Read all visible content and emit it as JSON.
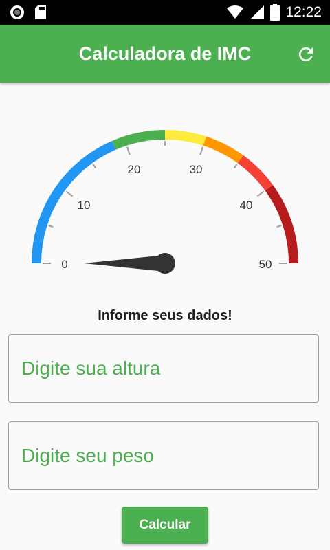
{
  "status_bar": {
    "time": "12:22",
    "icons": [
      "app-notification-icon",
      "sd-card-icon",
      "wifi-icon",
      "signal-icon",
      "battery-icon"
    ]
  },
  "app_bar": {
    "title": "Calculadora de IMC",
    "refresh_icon": "refresh-icon",
    "color": "#4caf50"
  },
  "gauge": {
    "min": 0,
    "max": 50,
    "value": 0,
    "labels": [
      "0",
      "10",
      "20",
      "30",
      "40",
      "50"
    ],
    "ranges": [
      {
        "from": 0,
        "to": 18.5,
        "color": "#2196f3"
      },
      {
        "from": 18.5,
        "to": 25,
        "color": "#4caf50"
      },
      {
        "from": 25,
        "to": 30,
        "color": "#ffeb3b"
      },
      {
        "from": 30,
        "to": 35,
        "color": "#ff9800"
      },
      {
        "from": 35,
        "to": 40,
        "color": "#f44336"
      },
      {
        "from": 40,
        "to": 50,
        "color": "#b71c1c"
      }
    ]
  },
  "form": {
    "prompt": "Informe seus dados!",
    "height_placeholder": "Digite sua altura",
    "weight_placeholder": "Digite seu peso",
    "button_label": "Calcular"
  }
}
